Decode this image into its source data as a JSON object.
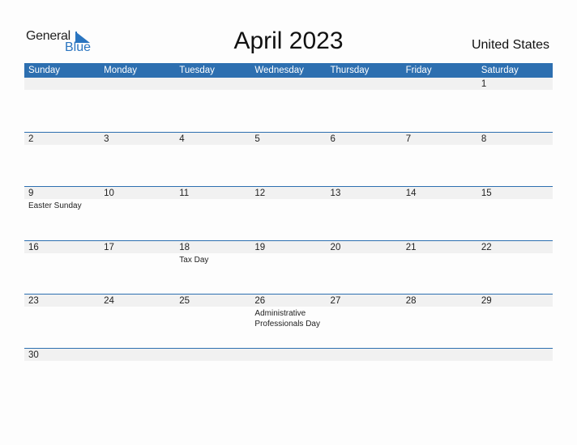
{
  "logo": {
    "general": "General",
    "blue": "Blue"
  },
  "title": "April 2023",
  "country": "United States",
  "colors": {
    "accent": "#2d6fb0",
    "band": "#f1f1f1"
  },
  "weekdays": [
    "Sunday",
    "Monday",
    "Tuesday",
    "Wednesday",
    "Thursday",
    "Friday",
    "Saturday"
  ],
  "weeks": [
    {
      "days": [
        "",
        "",
        "",
        "",
        "",
        "",
        "1"
      ],
      "events": [
        "",
        "",
        "",
        "",
        "",
        "",
        ""
      ]
    },
    {
      "days": [
        "2",
        "3",
        "4",
        "5",
        "6",
        "7",
        "8"
      ],
      "events": [
        "",
        "",
        "",
        "",
        "",
        "",
        ""
      ]
    },
    {
      "days": [
        "9",
        "10",
        "11",
        "12",
        "13",
        "14",
        "15"
      ],
      "events": [
        "Easter Sunday",
        "",
        "",
        "",
        "",
        "",
        ""
      ]
    },
    {
      "days": [
        "16",
        "17",
        "18",
        "19",
        "20",
        "21",
        "22"
      ],
      "events": [
        "",
        "",
        "Tax Day",
        "",
        "",
        "",
        ""
      ]
    },
    {
      "days": [
        "23",
        "24",
        "25",
        "26",
        "27",
        "28",
        "29"
      ],
      "events": [
        "",
        "",
        "",
        "Administrative Professionals Day",
        "",
        "",
        ""
      ]
    },
    {
      "days": [
        "30",
        "",
        "",
        "",
        "",
        "",
        ""
      ],
      "events": [
        "",
        "",
        "",
        "",
        "",
        "",
        ""
      ]
    }
  ]
}
